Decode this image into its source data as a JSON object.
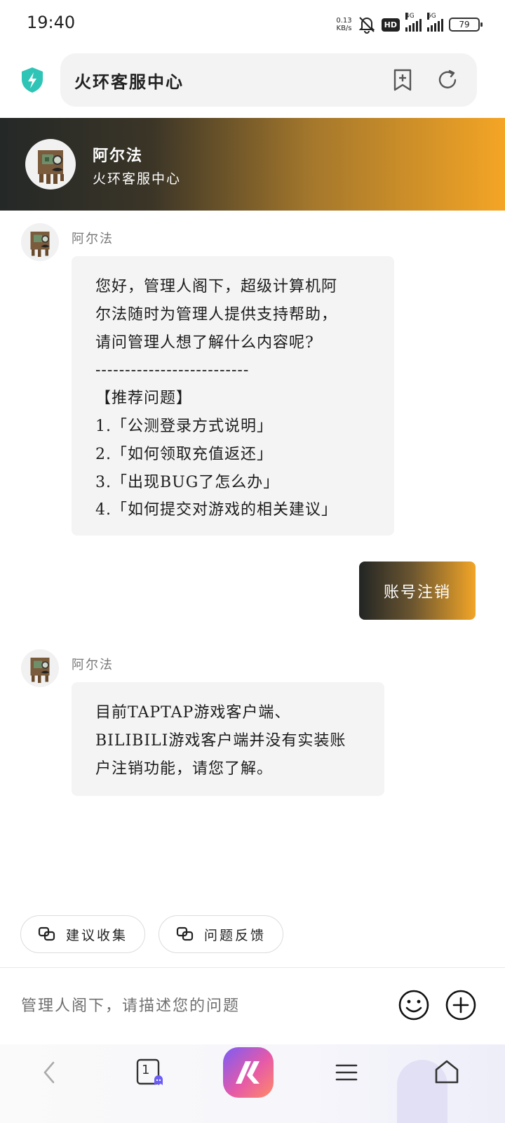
{
  "status_bar": {
    "time": "19:40",
    "net_speed_value": "0.13",
    "net_speed_unit": "KB/s",
    "hd_badge": "HD",
    "sim1_label": "4G",
    "sim2_label": "5G",
    "battery": "79"
  },
  "address_bar": {
    "title": "火环客服中心"
  },
  "header": {
    "agent_name": "阿尔法",
    "agent_subtitle": "火环客服中心"
  },
  "messages": [
    {
      "sender": "阿尔法",
      "lines": [
        "您好，管理人阁下，超级计算机阿",
        "尔法随时为管理人提供支持帮助，",
        "请问管理人想了解什么内容呢?",
        "--------------------------",
        "【推荐问题】",
        "1.「公测登录方式说明」",
        "2.「如何领取充值返还」",
        "3.「出现BUG了怎么办」",
        "4.「如何提交对游戏的相关建议」"
      ]
    },
    {
      "sender": "user",
      "text": "账号注销"
    },
    {
      "sender": "阿尔法",
      "lines": [
        "目前TAPTAP游戏客户端、",
        "BILIBILI游戏客户端并没有实装账",
        "户注销功能，请您了解。"
      ]
    }
  ],
  "quick_actions": [
    {
      "label": "建议收集",
      "icon": "link-icon"
    },
    {
      "label": "问题反馈",
      "icon": "link-icon"
    }
  ],
  "input": {
    "placeholder": "管理人阁下，请描述您的问题",
    "value": ""
  },
  "bottom_nav": {
    "tab_count": "1",
    "items": [
      "back-icon",
      "tabs-icon",
      "browser-logo-icon",
      "menu-icon",
      "home-icon"
    ]
  },
  "colors": {
    "gradient_dark": "#242827",
    "gradient_orange": "#f4a525",
    "shield": "#2ec4b6",
    "bubble_bg": "#f4f4f4"
  }
}
